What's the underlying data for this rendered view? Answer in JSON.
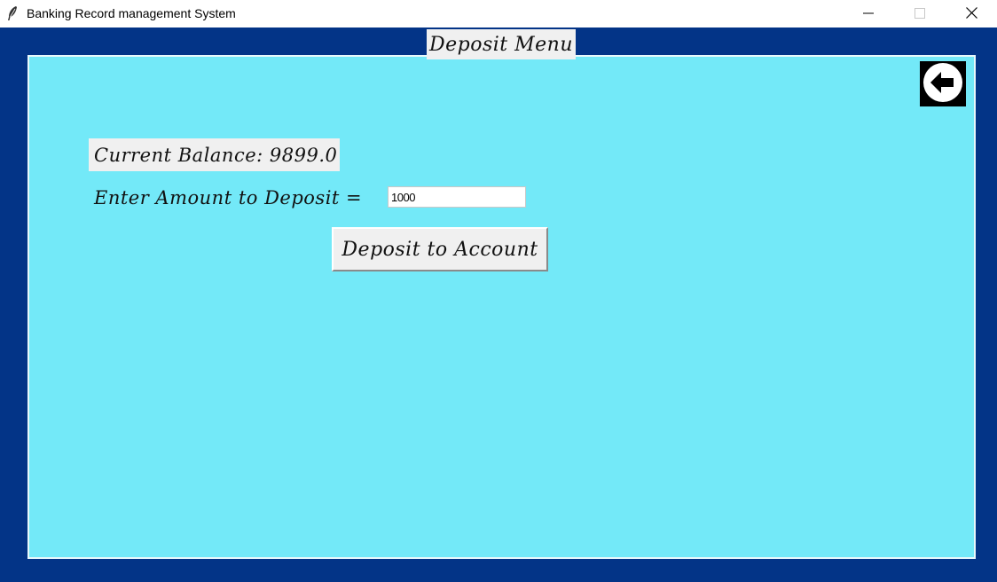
{
  "window": {
    "title": "Banking Record management System",
    "app_icon": "feather-icon",
    "controls": [
      "minimize-icon",
      "maximize-icon",
      "close-icon"
    ]
  },
  "colors": {
    "frame_background": "#033487",
    "panel_background": "#73e9f8",
    "label_background": "#f0f0f0",
    "back_button_background": "#000000"
  },
  "menu": {
    "title": "Deposit Menu"
  },
  "back_button": {
    "icon": "back-arrow-icon"
  },
  "balance": {
    "label": "Current Balance: 9899.0"
  },
  "deposit_form": {
    "amount_label": "Enter Amount to Deposit =",
    "amount_value": "1000",
    "submit_label": "Deposit to Account"
  }
}
